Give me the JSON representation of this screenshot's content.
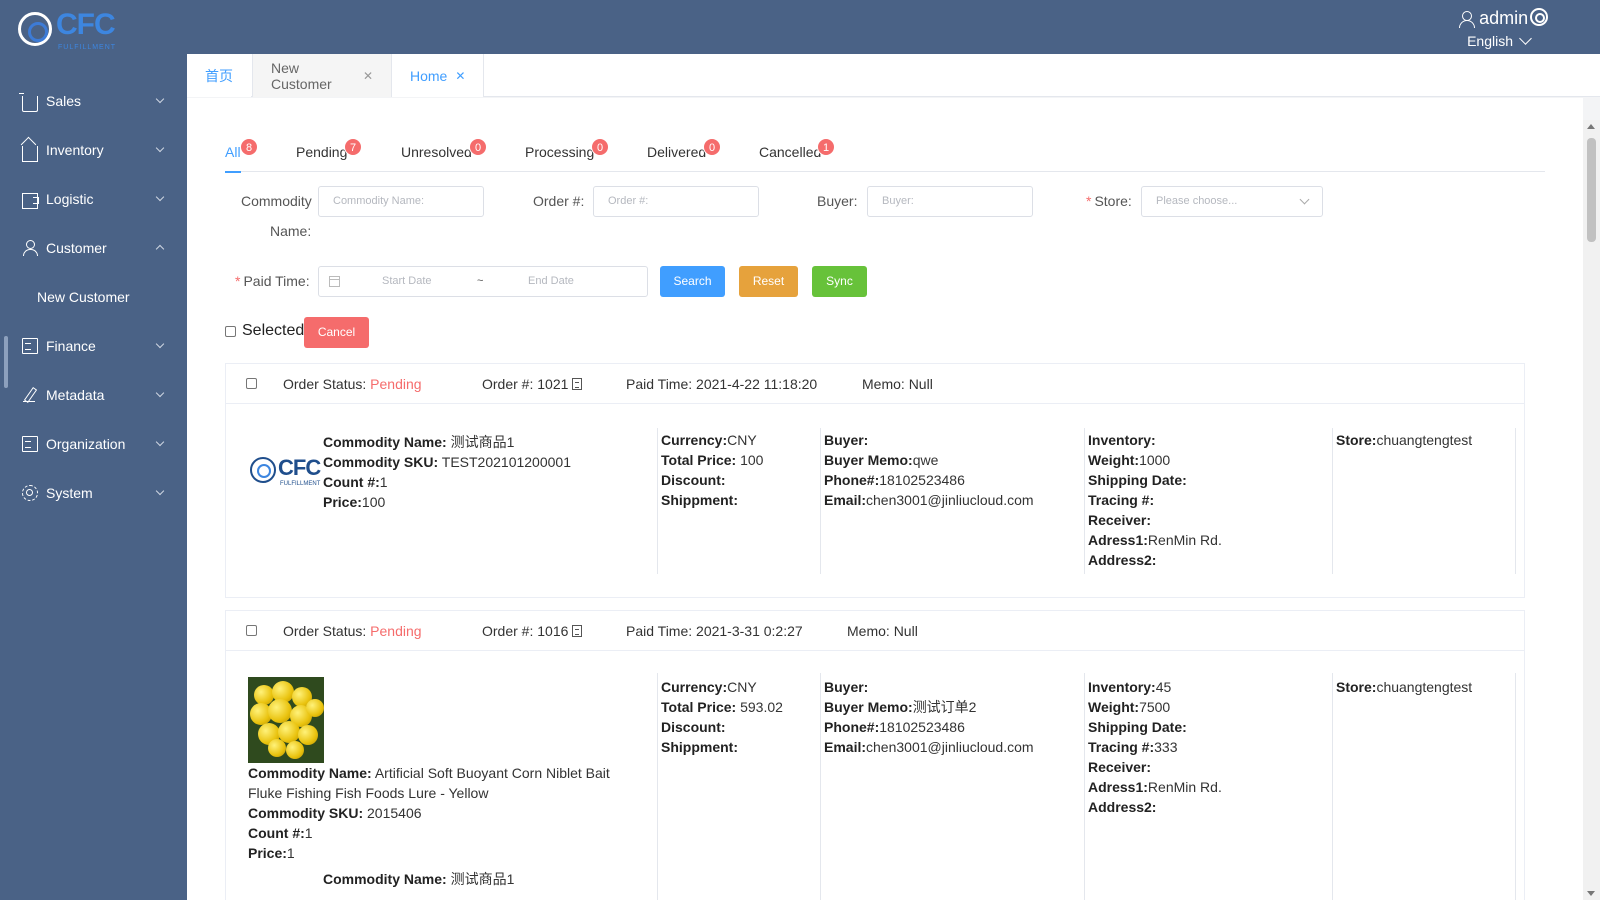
{
  "header": {
    "logo_text": "CFC",
    "logo_sub": "FULFILLMENT",
    "user": "admin",
    "language": "English"
  },
  "sidebar": {
    "items": [
      {
        "label": "Sales",
        "icon": "cart-icon"
      },
      {
        "label": "Inventory",
        "icon": "home-icon"
      },
      {
        "label": "Logistic",
        "icon": "truck-icon"
      },
      {
        "label": "Customer",
        "icon": "user-icon",
        "expanded": true
      },
      {
        "label": "New Customer",
        "sub": true
      },
      {
        "label": "Finance",
        "icon": "document-icon"
      },
      {
        "label": "Metadata",
        "icon": "pen-icon"
      },
      {
        "label": "Organization",
        "icon": "document-icon"
      },
      {
        "label": "System",
        "icon": "gear-icon"
      }
    ]
  },
  "page_tabs": [
    {
      "label": "首页",
      "closable": false
    },
    {
      "label": "New Customer",
      "closable": true
    },
    {
      "label": "Home",
      "closable": true,
      "active": true
    }
  ],
  "status_tabs": [
    {
      "label": "All",
      "count": "8",
      "active": true
    },
    {
      "label": "Pending",
      "count": "7"
    },
    {
      "label": "Unresolved",
      "count": "0"
    },
    {
      "label": "Processing",
      "count": "0"
    },
    {
      "label": "Delivered",
      "count": "0"
    },
    {
      "label": "Cancelled",
      "count": "1"
    }
  ],
  "filters": {
    "commodity_label_1": "Commodity",
    "commodity_label_2": "Name:",
    "commodity_placeholder": "Commodity Name:",
    "order_label": "Order #:",
    "order_placeholder": "Order #:",
    "buyer_label": "Buyer:",
    "buyer_placeholder": "Buyer:",
    "store_label": "Store:",
    "store_placeholder": "Please choose...",
    "paid_time_label": "Paid Time:",
    "start_date": "Start Date",
    "date_sep": "~",
    "end_date": "End Date",
    "search_btn": "Search",
    "reset_btn": "Reset",
    "sync_btn": "Sync"
  },
  "selection": {
    "selected_label": "Selected",
    "cancel_btn": "Cancel"
  },
  "orders": [
    {
      "status_label": "Order Status:",
      "status": "Pending",
      "order_label": "Order #:",
      "order_no": "1021",
      "paid_time_label": "Paid Time:",
      "paid_time": "2021-4-22 11:18:20",
      "memo_label": "Memo:",
      "memo": "Null",
      "image": "cfc-logo",
      "commodity_name": "测试商品1",
      "commodity_sku": "TEST202101200001",
      "count": "1",
      "price": "100",
      "currency": "CNY",
      "total_price": "100",
      "discount": "",
      "shippment": "",
      "buyer": "",
      "buyer_memo": "qwe",
      "phone": "18102523486",
      "email": "chen3001@jinliucloud.com",
      "inventory": "",
      "weight": "1000",
      "shipping_date": "",
      "tracing": "",
      "receiver": "",
      "adress1": "RenMin Rd.",
      "address2": "",
      "store": "chuangtengtest"
    },
    {
      "status_label": "Order Status:",
      "status": "Pending",
      "order_label": "Order #:",
      "order_no": "1016",
      "paid_time_label": "Paid Time:",
      "paid_time": "2021-3-31 0:2:27",
      "memo_label": "Memo:",
      "memo": "Null",
      "image": "yellow-flower",
      "commodity_name_line1": "Artificial Soft Buoyant Corn Niblet Bait",
      "commodity_name_line2": "Fluke Fishing Fish Foods Lure - Yellow",
      "commodity_sku": "2015406",
      "count": "1",
      "price": "1",
      "second_commodity_name": "测试商品1",
      "currency": "CNY",
      "total_price": "593.02",
      "discount": "",
      "shippment": "",
      "buyer": "",
      "buyer_memo": "测试订单2",
      "phone": "18102523486",
      "email": "chen3001@jinliucloud.com",
      "inventory": "45",
      "weight": "7500",
      "shipping_date": "",
      "tracing": "333",
      "receiver": "",
      "adress1": "RenMin Rd.",
      "address2": "",
      "store": "chuangtengtest"
    }
  ],
  "labels": {
    "commodity_name": "Commodity Name:",
    "commodity_sku": "Commodity SKU:",
    "count": "Count #:",
    "price": "Price:",
    "currency": "Currency:",
    "total_price": "Total Price:",
    "discount": "Discount:",
    "shippment": "Shippment:",
    "buyer": "Buyer:",
    "buyer_memo": "Buyer Memo:",
    "phone": "Phone#:",
    "email": "Email:",
    "inventory": "Inventory:",
    "weight": "Weight:",
    "shipping_date": "Shipping Date:",
    "tracing": "Tracing #:",
    "receiver": "Receiver:",
    "adress1": "Adress1:",
    "address2": "Address2:",
    "store": "Store:"
  },
  "colors": {
    "sidebar_bg": "#4a6286",
    "primary": "#409eff",
    "danger": "#f56c6c",
    "warning": "#e6a23c",
    "success": "#67c23a"
  }
}
